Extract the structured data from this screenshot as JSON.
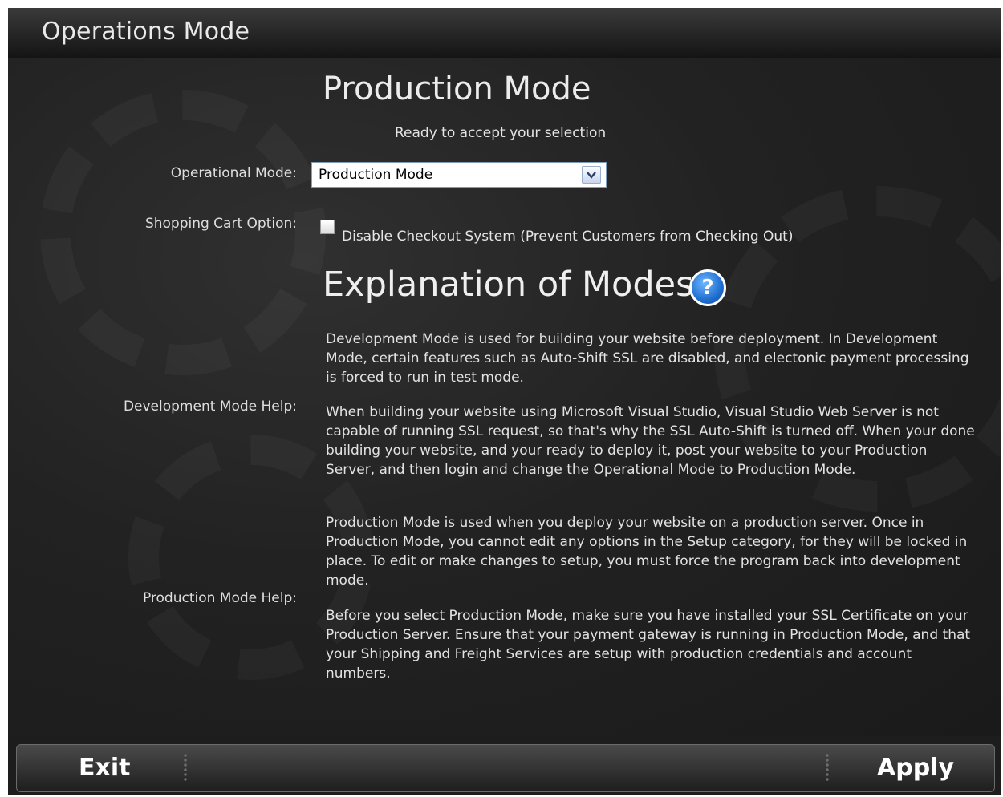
{
  "window": {
    "title": "Operations Mode"
  },
  "main": {
    "mode_title": "Production Mode",
    "status_text": "Ready to accept your selection",
    "operational_mode_label": "Operational Mode:",
    "operational_mode_value": "Production Mode",
    "shopping_cart_label": "Shopping Cart Option:",
    "disable_checkout_checked": false,
    "disable_checkout_label": "Disable Checkout System (Prevent Customers from Checking Out)",
    "explanation_title": "Explanation of Modes",
    "help_icon_glyph": "?",
    "development_help_label": "Development Mode Help:",
    "development_help_p1": "Development Mode is used for building your website before deployment. In Development Mode, certain features such as Auto-Shift SSL are disabled, and electonic payment processing is forced to run in test mode.",
    "development_help_p2": "When building your website using Microsoft Visual Studio, Visual Studio Web Server is not capable of running SSL request, so that's why the SSL Auto-Shift is turned off. When your done building your website, and your ready to deploy it, post your website to your Production Server, and then login and change the Operational Mode to Production Mode.",
    "production_help_label": "Production Mode Help:",
    "production_help_p1": "Production Mode is used when you deploy your website on a production server. Once in Production Mode, you cannot edit any options in the Setup category, for they will be locked in place. To edit or make changes to setup, you must force the program back into development mode.",
    "production_help_p2": "Before you select Production Mode, make sure you have installed your SSL Certificate on your Production Server. Ensure that your payment gateway is running in Production Mode, and that your Shipping and Freight Services are setup with production credentials and account numbers."
  },
  "footer": {
    "exit_label": "Exit",
    "apply_label": "Apply"
  },
  "colors": {
    "background": "#1d1d1d",
    "text": "#e2e2e2",
    "help_icon_blue": "#1f6fd0"
  },
  "icons": {
    "help": "question-circle-icon",
    "dropdown": "chevron-down-icon"
  }
}
